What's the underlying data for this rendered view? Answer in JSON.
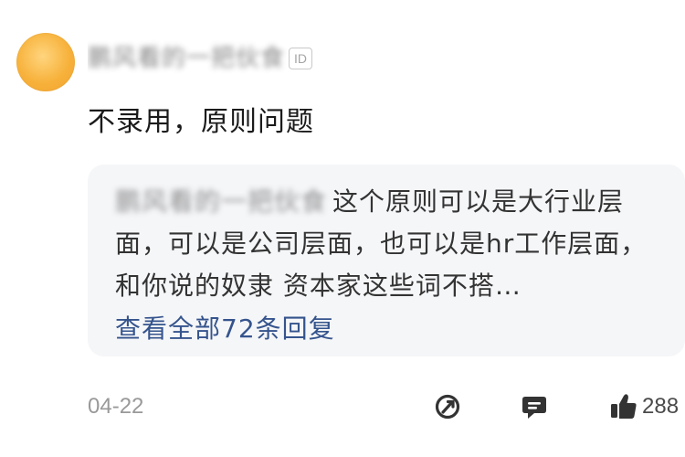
{
  "user": {
    "name": "鹏风看的一把伙食",
    "id_badge": "ID"
  },
  "comment": {
    "text": "不录用，原则问题"
  },
  "reply": {
    "author": "鹏风看的一把伙食",
    "text": "这个原则可以是大行业层面，可以是公司层面，也可以是hr工作层面，和你说的奴隶 资本家这些词不搭…",
    "view_all": "查看全部72条回复"
  },
  "footer": {
    "date": "04-22",
    "like_count": "288"
  }
}
